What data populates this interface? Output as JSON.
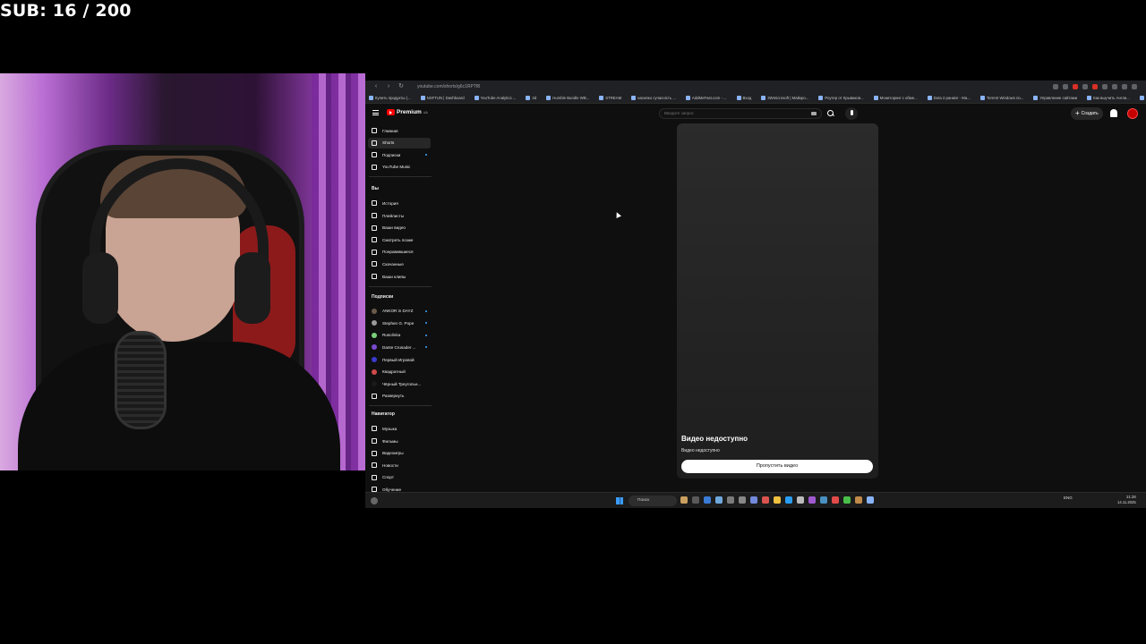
{
  "overlay": {
    "sub_counter": "SUB: 16 / 200"
  },
  "browser": {
    "url": "youtube.com/shorts/g6c1RPTf8",
    "bookmarks": [
      "Купить продукты (...",
      "NSFTUN | Dashboard",
      "YouTube Analytics ...",
      "3d",
      "Humble Bundle WB...",
      "STREAM",
      "насипко сучасність ...",
      "AddMeFast.com - ...",
      "Вход",
      "3Wmicrosoft | Майкро...",
      "Роутер от Крываков...",
      "Мониторинг с обме...",
      "Dota 2 ранкінг - Ма...",
      "Torrent Windows по...",
      "Управление сайтами",
      "Как выучить Англи...",
      "Все закладки"
    ]
  },
  "youtube": {
    "logo": "Premium",
    "logo_region": "UA",
    "search_placeholder": "Введите запрос",
    "create_label": "Создать",
    "sidebar": {
      "main": [
        {
          "label": "Главная",
          "icon": "home-icon"
        },
        {
          "label": "Shorts",
          "icon": "shorts-icon",
          "active": true
        },
        {
          "label": "Подписки",
          "icon": "subscriptions-icon"
        },
        {
          "label": "YouTube Music",
          "icon": "music-icon"
        }
      ],
      "you_heading": "Вы",
      "you": [
        {
          "label": "История",
          "icon": "history-icon"
        },
        {
          "label": "Плейлисты",
          "icon": "playlist-icon"
        },
        {
          "label": "Ваши видео",
          "icon": "your-videos-icon"
        },
        {
          "label": "Смотреть позже",
          "icon": "watch-later-icon"
        },
        {
          "label": "Понравившиеся",
          "icon": "like-icon"
        },
        {
          "label": "Скачанные",
          "icon": "download-icon"
        },
        {
          "label": "Ваши клипы",
          "icon": "clip-icon"
        }
      ],
      "subs_heading": "Подписки",
      "subscriptions": [
        {
          "label": "ANKOR in DAYZ",
          "color": "#6a5a4a"
        },
        {
          "label": "Stephen G. Pope",
          "color": "#9a9a9a"
        },
        {
          "label": "Rusolinka",
          "color": "#7ad07a"
        },
        {
          "label": "Dante Crusader ...",
          "color": "#7a4ad0"
        },
        {
          "label": "Первый Игровой",
          "color": "#3a3ad0"
        },
        {
          "label": "Квадратный",
          "color": "#d04a4a"
        },
        {
          "label": "Чёрный Треугольн...",
          "color": "#1a1a1a"
        }
      ],
      "expand_label": "Развернуть",
      "nav_heading": "Навигатор",
      "navigator": [
        {
          "label": "Музыка",
          "icon": "music-note-icon"
        },
        {
          "label": "Фильмы",
          "icon": "film-icon"
        },
        {
          "label": "Видеоигры",
          "icon": "gamepad-icon"
        },
        {
          "label": "Новости",
          "icon": "news-icon"
        },
        {
          "label": "Спорт",
          "icon": "trophy-icon"
        },
        {
          "label": "Обучение",
          "icon": "lightbulb-icon"
        }
      ]
    },
    "short": {
      "title": "Видео недоступно",
      "subtitle": "Видео недоступно",
      "skip_label": "Пропустить видео"
    }
  },
  "taskbar": {
    "search_label": "Поиск",
    "lang": "ENG",
    "time": "21:28",
    "date": "14.11.2025"
  }
}
